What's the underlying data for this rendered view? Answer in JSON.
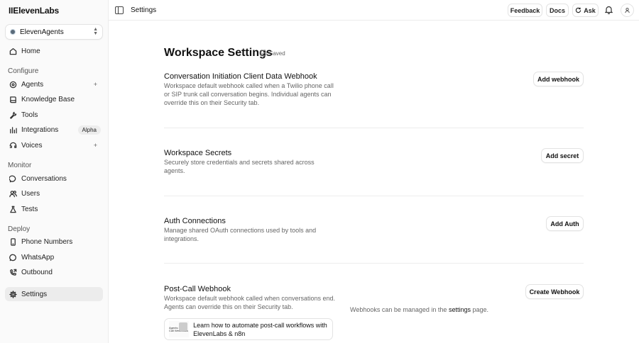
{
  "sidebar": {
    "logo": "IIElevenLabs",
    "agent_switcher": "ElevenAgents",
    "home": "Home",
    "sections": {
      "configure": "Configure",
      "monitor": "Monitor",
      "deploy": "Deploy"
    },
    "items": {
      "agents": "Agents",
      "knowledge_base": "Knowledge Base",
      "tools": "Tools",
      "integrations": "Integrations",
      "integrations_badge": "Alpha",
      "voices": "Voices",
      "conversations": "Conversations",
      "users": "Users",
      "tests": "Tests",
      "phone_numbers": "Phone Numbers",
      "whatsapp": "WhatsApp",
      "outbound": "Outbound",
      "settings": "Settings"
    },
    "plus": "+"
  },
  "topbar": {
    "title": "Settings",
    "feedback": "Feedback",
    "docs": "Docs",
    "ask": "Ask"
  },
  "main": {
    "title": "Workspace Settings",
    "saved": "Saved",
    "sections": [
      {
        "title": "Conversation Initiation Client Data Webhook",
        "desc": "Workspace default webhook called when a Twilio phone call or SIP trunk call conversation begins. Individual agents can override this on their Security tab.",
        "button": "Add webhook"
      },
      {
        "title": "Workspace Secrets",
        "desc": "Securely store credentials and secrets shared across agents.",
        "button": "Add secret"
      },
      {
        "title": "Auth Connections",
        "desc": "Manage shared OAuth connections used by tools and integrations.",
        "button": "Add Auth"
      },
      {
        "title": "Post-Call Webhook",
        "desc": "Workspace default webhook called when conversations end. Agents can override this on their Security tab.",
        "button": "Create Webhook"
      }
    ],
    "webhooks_note_prefix": "Webhooks can be managed in the",
    "webhooks_note_link": "settings",
    "webhooks_note_suffix": "page.",
    "learn_card": {
      "text": "Learn how to automate post-call workflows with ElevenLabs & n8n",
      "thumb_text": "Agents Post-Call Webhooks"
    }
  }
}
